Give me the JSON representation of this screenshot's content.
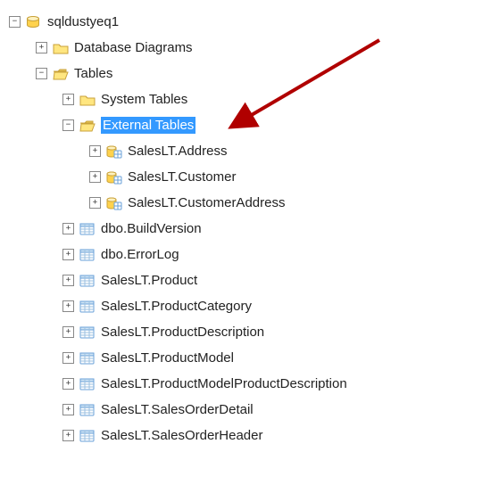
{
  "root": {
    "name": "sqldustyeq1",
    "expanded": true,
    "children": [
      {
        "name": "Database Diagrams",
        "type": "folder",
        "expanded": false
      },
      {
        "name": "Tables",
        "type": "folder",
        "expanded": true,
        "children": [
          {
            "name": "System Tables",
            "type": "folder",
            "expanded": false
          },
          {
            "name": "External Tables",
            "type": "folder",
            "expanded": true,
            "selected": true,
            "children": [
              {
                "name": "SalesLT.Address",
                "type": "external-table",
                "expanded": false
              },
              {
                "name": "SalesLT.Customer",
                "type": "external-table",
                "expanded": false
              },
              {
                "name": "SalesLT.CustomerAddress",
                "type": "external-table",
                "expanded": false
              }
            ]
          },
          {
            "name": "dbo.BuildVersion",
            "type": "table",
            "expanded": false
          },
          {
            "name": "dbo.ErrorLog",
            "type": "table",
            "expanded": false
          },
          {
            "name": "SalesLT.Product",
            "type": "table",
            "expanded": false
          },
          {
            "name": "SalesLT.ProductCategory",
            "type": "table",
            "expanded": false
          },
          {
            "name": "SalesLT.ProductDescription",
            "type": "table",
            "expanded": false
          },
          {
            "name": "SalesLT.ProductModel",
            "type": "table",
            "expanded": false
          },
          {
            "name": "SalesLT.ProductModelProductDescription",
            "type": "table",
            "expanded": false
          },
          {
            "name": "SalesLT.SalesOrderDetail",
            "type": "table",
            "expanded": false
          },
          {
            "name": "SalesLT.SalesOrderHeader",
            "type": "table",
            "expanded": false
          }
        ]
      }
    ]
  }
}
